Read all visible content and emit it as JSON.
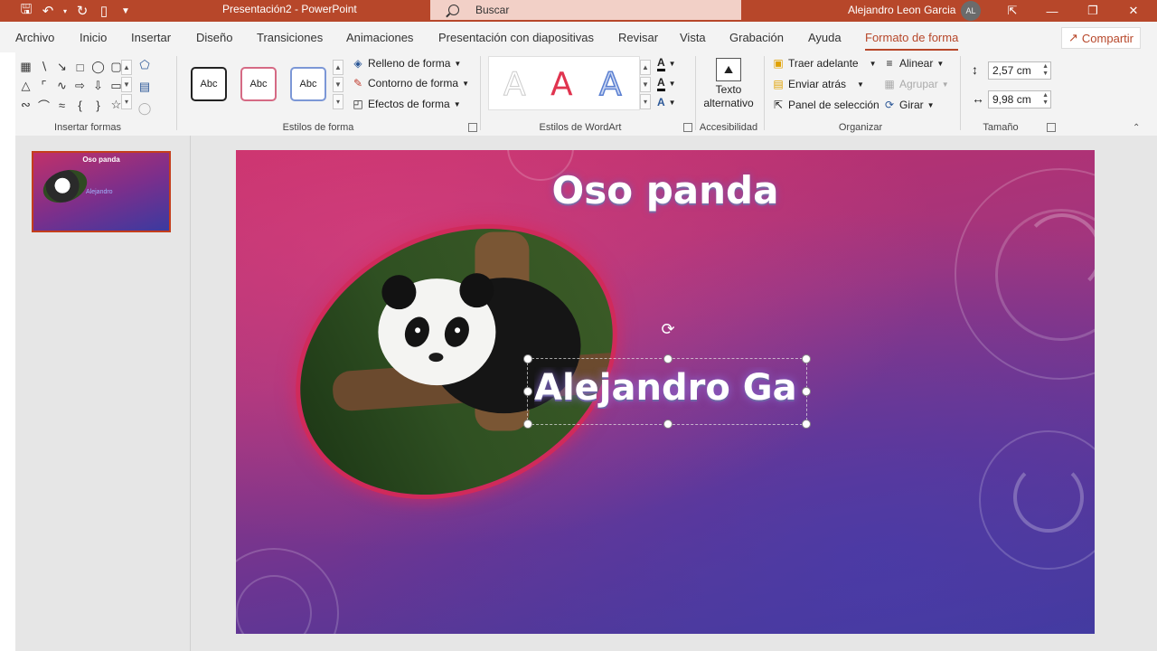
{
  "app": {
    "doc_title": "Presentación2 - PowerPoint",
    "search_placeholder": "Buscar",
    "user_name": "Alejandro Leon Garcia",
    "user_initials": "AL"
  },
  "window_controls": {
    "ribbon_display": "⇱",
    "minimize": "—",
    "restore": "❐",
    "close": "✕"
  },
  "tabs": [
    {
      "label": "Archivo"
    },
    {
      "label": "Inicio"
    },
    {
      "label": "Insertar"
    },
    {
      "label": "Diseño"
    },
    {
      "label": "Transiciones"
    },
    {
      "label": "Animaciones"
    },
    {
      "label": "Presentación con diapositivas"
    },
    {
      "label": "Revisar"
    },
    {
      "label": "Vista"
    },
    {
      "label": "Grabación"
    },
    {
      "label": "Ayuda"
    },
    {
      "label": "Formato de forma",
      "active": true
    }
  ],
  "share_label": "Compartir",
  "ribbon": {
    "insert_shapes_label": "Insertar formas",
    "shape_styles_label": "Estilos de forma",
    "style_samples": [
      "Abc",
      "Abc",
      "Abc"
    ],
    "shape_fill": "Relleno de forma",
    "shape_outline": "Contorno de forma",
    "shape_effects": "Efectos de forma",
    "wordart_label": "Estilos de WordArt",
    "wordart_sample": "A",
    "alt_text": "Texto alternativo",
    "accessibility_label": "Accesibilidad",
    "bring_forward": "Traer adelante",
    "send_backward": "Enviar atrás",
    "selection_pane": "Panel de selección",
    "align": "Alinear",
    "group": "Agrupar",
    "rotate": "Girar",
    "arrange_label": "Organizar",
    "height_value": "2,57 cm",
    "width_value": "9,98 cm",
    "size_label": "Tamaño"
  },
  "thumbnail": {
    "title": "Oso panda",
    "name": "Alejandro"
  },
  "slide": {
    "title": "Oso panda",
    "name_text": "Alejandro Ga"
  },
  "colors": {
    "accent": "#b7472a",
    "frame": "#d02a5b"
  }
}
